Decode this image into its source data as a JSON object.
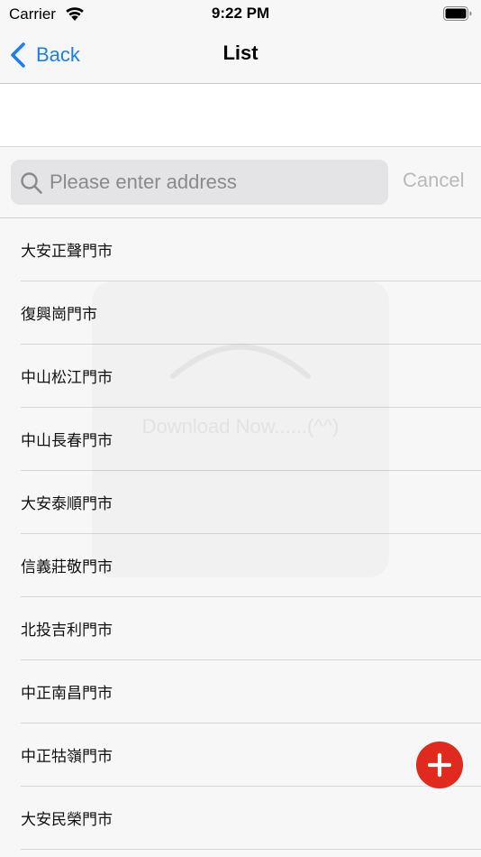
{
  "status_bar": {
    "carrier": "Carrier",
    "time": "9:22 PM",
    "wifi_icon": "wifi-icon",
    "battery_icon": "battery-icon"
  },
  "nav": {
    "back_label": "Back",
    "back_icon": "chevron-left-icon",
    "title": "List",
    "accent_color": "#1a7ef5"
  },
  "search": {
    "placeholder": "Please enter address",
    "value": "",
    "cancel_label": "Cancel",
    "icon": "search-icon"
  },
  "stores": [
    {
      "label": "大安正聲門市"
    },
    {
      "label": "復興崗門市"
    },
    {
      "label": "中山松江門市"
    },
    {
      "label": "中山長春門市"
    },
    {
      "label": "大安泰順門市"
    },
    {
      "label": "信義莊敬門市"
    },
    {
      "label": "北投吉利門市"
    },
    {
      "label": "中正南昌門市"
    },
    {
      "label": "中正牯嶺門市"
    },
    {
      "label": "大安民榮門市"
    }
  ],
  "hud": {
    "text": "Download Now......(^^)"
  },
  "fab": {
    "icon": "plus-icon",
    "color": "#e02a1e"
  }
}
